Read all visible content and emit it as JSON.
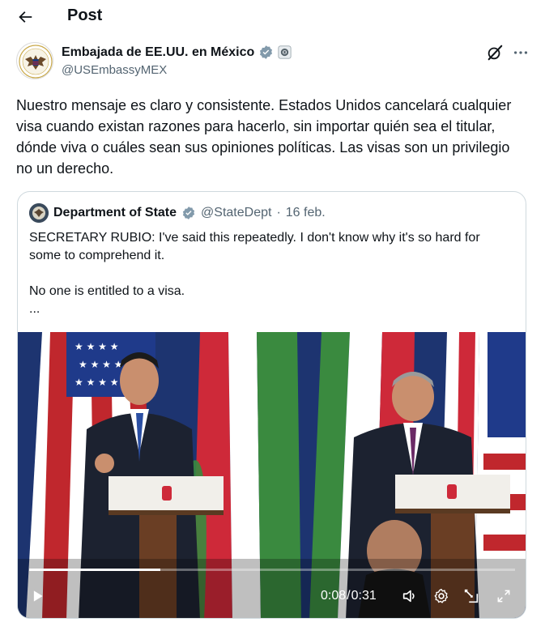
{
  "header": {
    "back_icon": "arrow-left-icon",
    "title": "Post"
  },
  "author": {
    "name": "Embajada de EE.UU. en México",
    "handle": "@USEmbassyMEX",
    "verified_icon": "verified-badge-icon",
    "affiliate_icon": "government-seal-icon",
    "grok_icon": "grok-icon",
    "more_icon": "more-icon"
  },
  "post": {
    "text": "Nuestro mensaje es claro y consistente. Estados Unidos cancelará cualquier visa cuando existan razones para hacerlo, sin importar quién sea el titular, dónde viva o cuáles sean sus opiniones políticas. Las visas son un privilegio no un derecho."
  },
  "quote": {
    "name": "Department of State",
    "handle": "@StateDept",
    "separator": "·",
    "date": "16 feb.",
    "lines": [
      "SECRETARY RUBIO: I've said this repeatedly. I don't know why it's so hard for",
      "some to comprehend it.",
      "",
      "No one is entitled to a visa.",
      "..."
    ]
  },
  "video": {
    "current_time": "0:08",
    "separator": "/",
    "duration": "0:31",
    "progress_fraction": 0.27,
    "icons": [
      "play-icon",
      "volume-icon",
      "settings-icon",
      "picture-in-picture-icon",
      "fullscreen-icon"
    ]
  },
  "colors": {
    "text": "#0f1419",
    "secondary": "#536471",
    "border": "#cfd9de",
    "verified": "#829aab"
  }
}
